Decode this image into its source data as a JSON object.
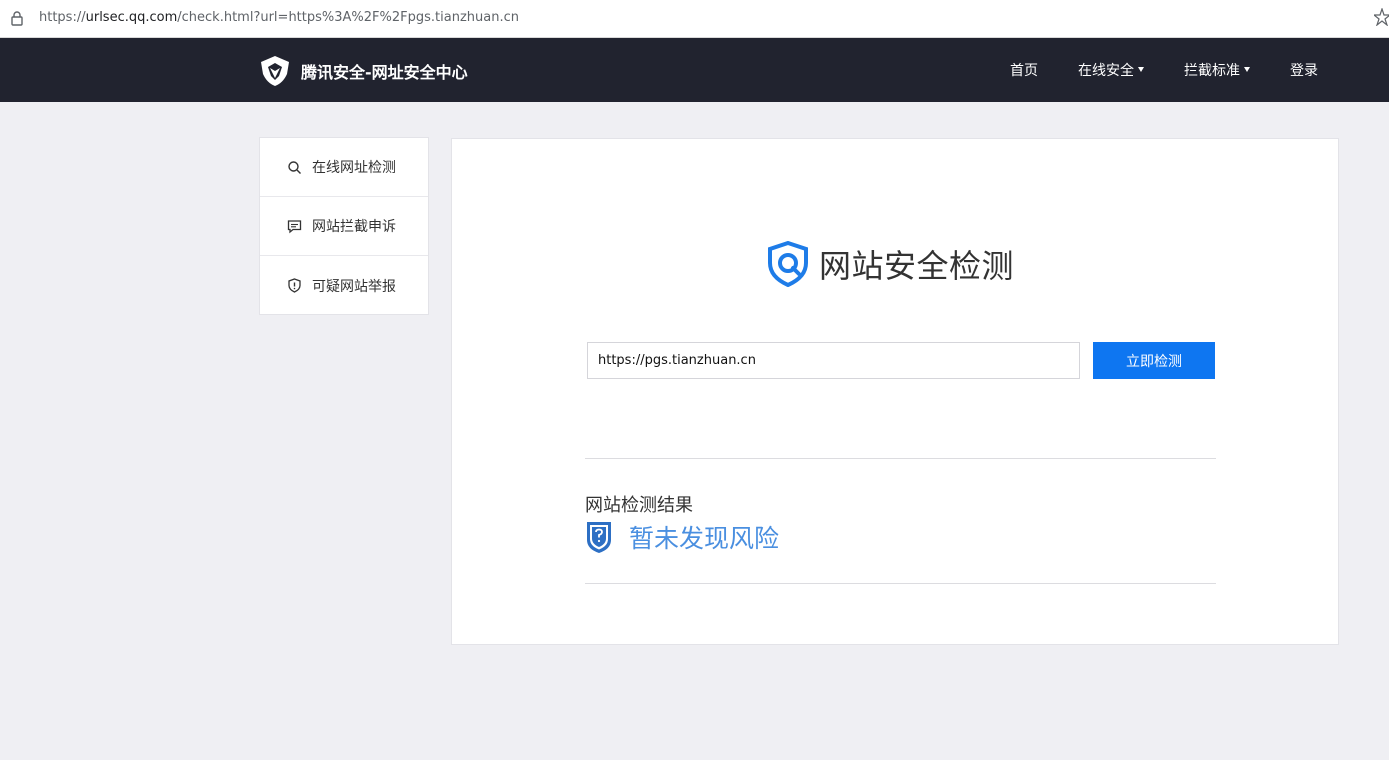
{
  "browser": {
    "url_prefix": "https://",
    "url_host": "urlsec.qq.com",
    "url_rest": "/check.html?url=https%3A%2F%2Fpgs.tianzhuan.cn"
  },
  "header": {
    "brand": "腾讯安全-网址安全中心",
    "nav": {
      "home": "首页",
      "online_security": "在线安全",
      "block_standard": "拦截标准",
      "login": "登录"
    }
  },
  "sidebar": {
    "items": [
      {
        "label": "在线网址检测",
        "icon": "search-icon"
      },
      {
        "label": "网站拦截申诉",
        "icon": "message-icon"
      },
      {
        "label": "可疑网站举报",
        "icon": "shield-alert-icon"
      }
    ]
  },
  "main": {
    "title": "网站安全检测",
    "input_value": "https://pgs.tianzhuan.cn",
    "check_button": "立即检测",
    "result_label": "网站检测结果",
    "result_text": "暂未发现风险"
  },
  "colors": {
    "header_bg": "#21232f",
    "accent_blue": "#0e76f1",
    "result_blue": "#4a8fe0",
    "page_bg": "#efeff3"
  }
}
